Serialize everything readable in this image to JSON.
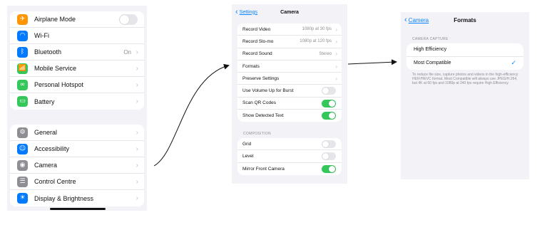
{
  "settings": {
    "group1": [
      {
        "label": "Airplane Mode",
        "icon": "airplane-icon",
        "color": "#ff9500",
        "control": "toggle",
        "on": false
      },
      {
        "label": "Wi-Fi",
        "icon": "wifi-icon",
        "color": "#007aff",
        "control": "none"
      },
      {
        "label": "Bluetooth",
        "icon": "bluetooth-icon",
        "color": "#007aff",
        "control": "chevron",
        "value": "On"
      },
      {
        "label": "Mobile Service",
        "icon": "antenna-icon",
        "color": "#34c759",
        "control": "chevron"
      },
      {
        "label": "Personal Hotspot",
        "icon": "hotspot-icon",
        "color": "#34c759",
        "control": "chevron"
      },
      {
        "label": "Battery",
        "icon": "battery-icon",
        "color": "#34c759",
        "control": "chevron"
      }
    ],
    "group2": [
      {
        "label": "General",
        "icon": "gear-icon",
        "color": "#8e8e93",
        "control": "chevron"
      },
      {
        "label": "Accessibility",
        "icon": "accessibility-icon",
        "color": "#007aff",
        "control": "chevron"
      },
      {
        "label": "Camera",
        "icon": "camera-icon",
        "color": "#8e8e93",
        "control": "chevron"
      },
      {
        "label": "Control Centre",
        "icon": "control-centre-icon",
        "color": "#8e8e93",
        "control": "chevron"
      },
      {
        "label": "Display & Brightness",
        "icon": "sun-icon",
        "color": "#007aff",
        "control": "chevron"
      }
    ]
  },
  "camera": {
    "back_label": "Settings",
    "title": "Camera",
    "group1": [
      {
        "label": "Record Video",
        "value": "1080p at 30 fps",
        "control": "chevron"
      },
      {
        "label": "Record Slo-mo",
        "value": "1080p at 120 fps",
        "control": "chevron"
      },
      {
        "label": "Record Sound",
        "value": "Stereo",
        "control": "chevron"
      },
      {
        "label": "Formats",
        "control": "chevron"
      },
      {
        "label": "Preserve Settings",
        "control": "chevron"
      },
      {
        "label": "Use Volume Up for Burst",
        "control": "toggle",
        "on": false
      },
      {
        "label": "Scan QR Codes",
        "control": "toggle",
        "on": true
      },
      {
        "label": "Show Detected Text",
        "control": "toggle",
        "on": true
      }
    ],
    "section_label": "COMPOSITION",
    "group2": [
      {
        "label": "Grid",
        "control": "toggle",
        "on": false
      },
      {
        "label": "Level",
        "control": "toggle",
        "on": false
      },
      {
        "label": "Mirror Front Camera",
        "control": "toggle",
        "on": true
      }
    ]
  },
  "formats": {
    "back_label": "Camera",
    "title": "Formats",
    "section_label": "CAMERA CAPTURE",
    "options": [
      {
        "label": "High Efficiency",
        "selected": false
      },
      {
        "label": "Most Compatible",
        "selected": true
      }
    ],
    "footer": "To reduce file size, capture photos and videos in the high-efficiency HEIF/HEVC format. Most Compatible will always use JPEG/H.264, but 4K at 60 fps and 1080p at 240 fps require High Efficiency."
  },
  "colors": {
    "accent": "#0a84ff",
    "toggle_on": "#34c759",
    "background": "#f2f2f7"
  }
}
